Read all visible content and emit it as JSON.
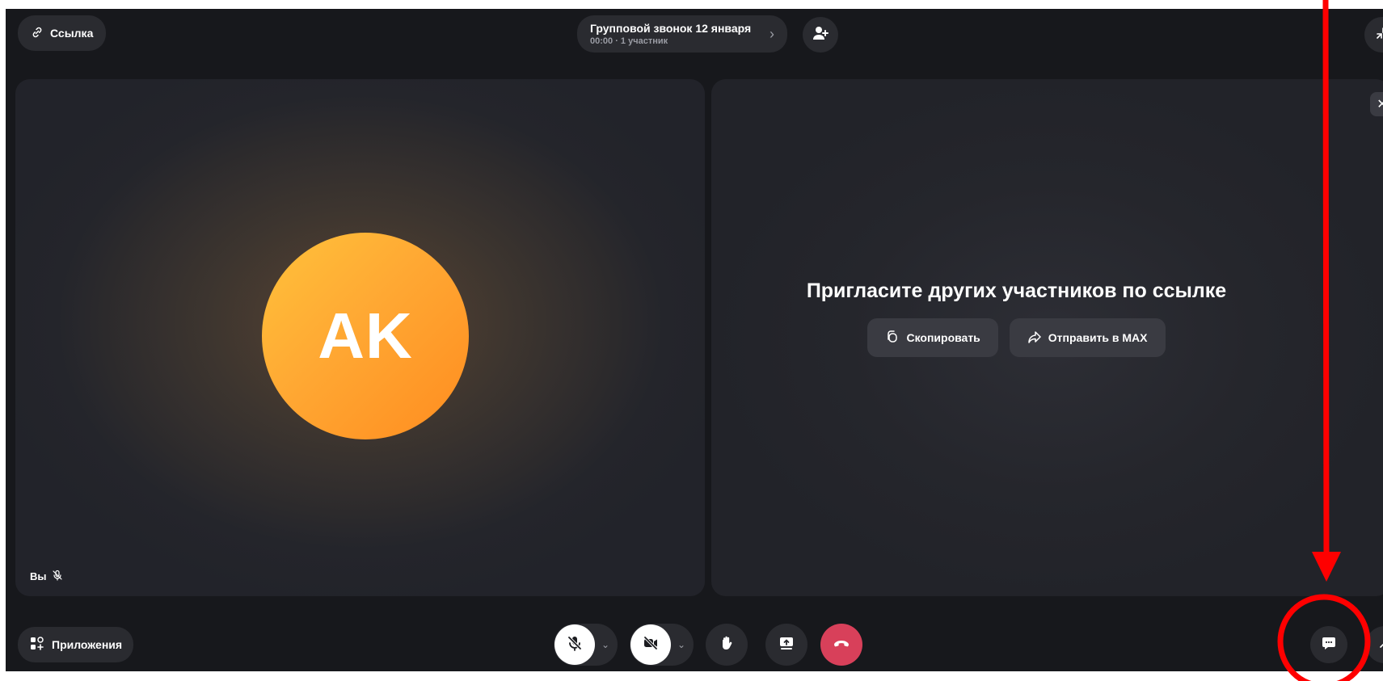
{
  "topbar": {
    "link_label": "Ссылка",
    "call_title": "Групповой звонок 12 января",
    "call_subtitle": "00:00 · 1 участник"
  },
  "self_tile": {
    "initials": "AK",
    "name_label": "Вы",
    "avatar_colors": [
      "#ffc23b",
      "#ff8c1f"
    ]
  },
  "invite": {
    "title": "Пригласите других участников по ссылке",
    "copy_label": "Скопировать",
    "send_label": "Отправить в MAX"
  },
  "bottombar": {
    "apps_label": "Приложения",
    "end_call_color": "#d8405a"
  },
  "icons": {
    "link": "link-icon",
    "add_user": "add-user-icon",
    "minimize": "minimize-icon",
    "close": "close-icon",
    "mic_off": "mic-off-icon",
    "camera_off": "camera-off-icon",
    "raise_hand": "raise-hand-icon",
    "screen_share": "screen-share-icon",
    "end_call": "end-call-icon",
    "chat": "chat-icon",
    "apps": "apps-icon",
    "copy": "copy-icon",
    "share": "share-icon"
  },
  "annotation": {
    "color": "#ff0000"
  }
}
